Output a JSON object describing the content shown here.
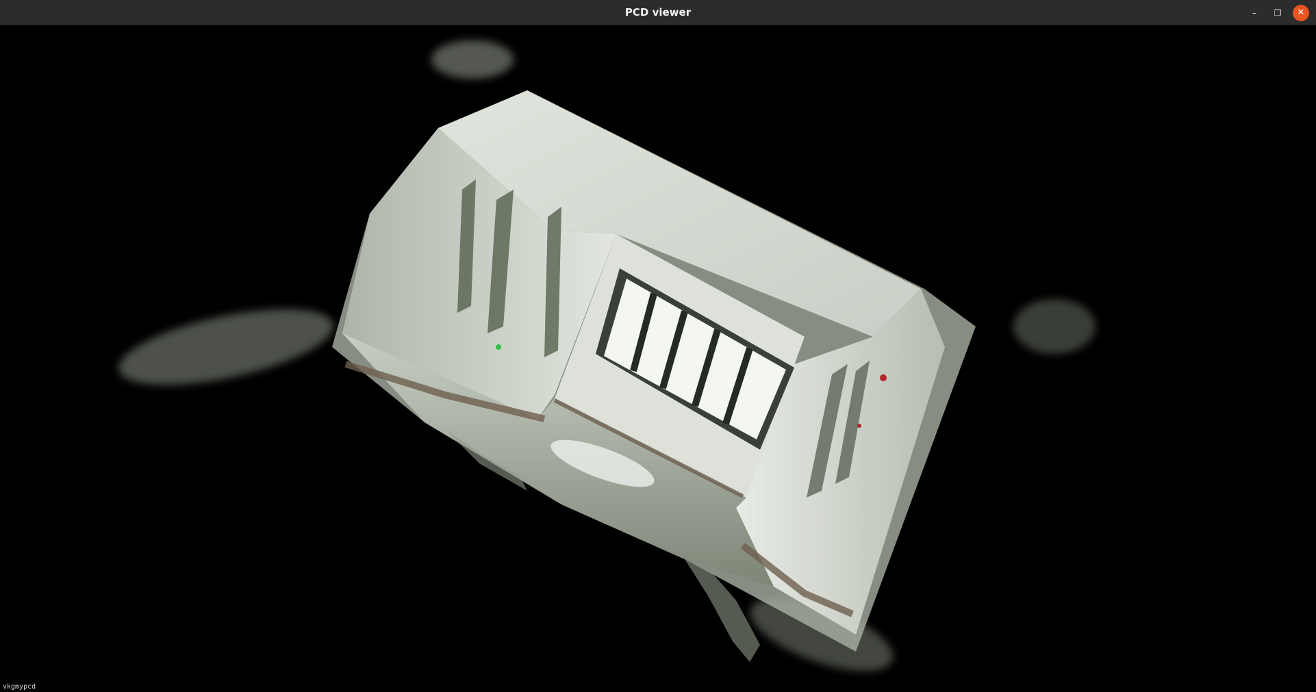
{
  "window": {
    "title": "PCD viewer",
    "controls": {
      "minimize": "–",
      "restore": "❐",
      "close": "✕"
    }
  },
  "viewport": {
    "content": "point-cloud",
    "background_color": "#000000",
    "point_color": "#d4dccd",
    "status_text": "vkgmypcd"
  },
  "colors": {
    "titlebar": "#2c2c2c",
    "close_button": "#e95420"
  }
}
